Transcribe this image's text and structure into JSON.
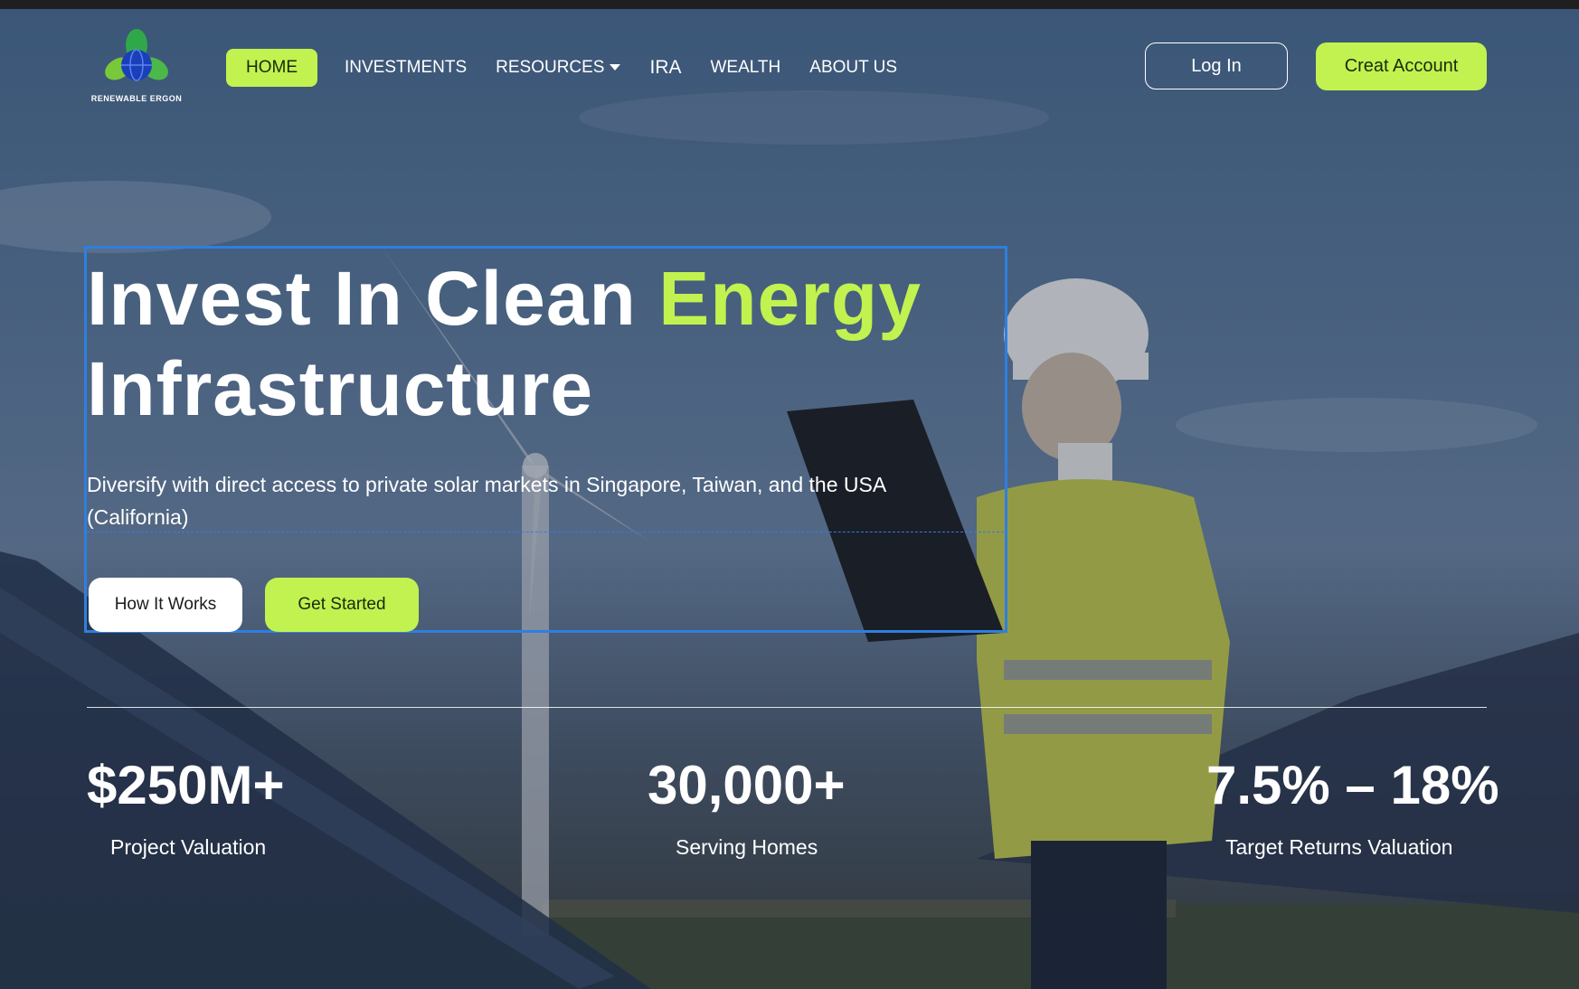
{
  "brand": {
    "name": "RENEWABLE ERGON"
  },
  "nav": {
    "items": [
      {
        "label": "HOME",
        "active": true
      },
      {
        "label": "INVESTMENTS"
      },
      {
        "label": "RESOURCES",
        "has_dropdown": true
      },
      {
        "label": "IRA"
      },
      {
        "label": "WEALTH"
      },
      {
        "label": "ABOUT US"
      }
    ],
    "login_label": "Log In",
    "create_label": "Creat Account"
  },
  "hero": {
    "title_part1": "Invest In Clean ",
    "title_accent": "Energy",
    "title_part2": "Infrastructure",
    "subtitle": "Diversify with direct access to private solar markets in Singapore, Taiwan, and the USA (California)",
    "how_label": "How It Works",
    "start_label": "Get Started"
  },
  "stats": [
    {
      "value": "$250M+",
      "label": "Project Valuation"
    },
    {
      "value": "30,000+",
      "label": "Serving  Homes"
    },
    {
      "value": "7.5% – 18%",
      "label": "Target Returns Valuation"
    }
  ],
  "colors": {
    "accent": "#c1f24f",
    "selection": "#2e7fe0"
  },
  "icons": {
    "logo": "globe-leaves-icon",
    "dropdown": "caret-down-icon"
  }
}
